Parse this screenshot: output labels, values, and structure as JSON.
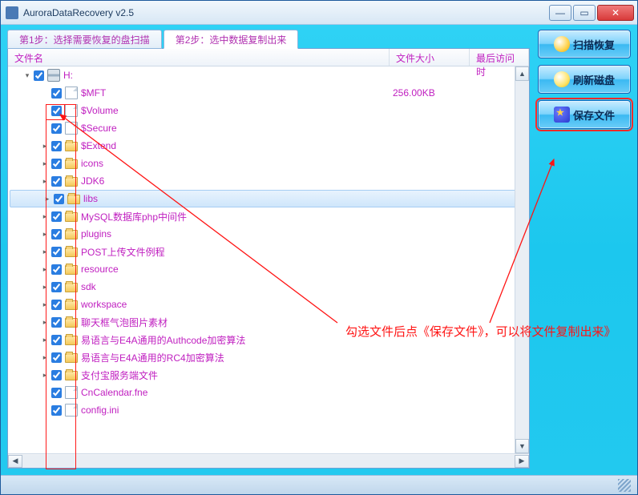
{
  "window": {
    "title": "AuroraDataRecovery v2.5"
  },
  "tabs": {
    "step1": "第1步：选择需要恢复的盘扫描",
    "step2": "第2步：选中数据复制出来"
  },
  "columns": {
    "name": "文件名",
    "size": "文件大小",
    "date": "最后访问时"
  },
  "tree": {
    "root": {
      "label": "H:",
      "size": ""
    },
    "items": [
      {
        "label": "$MFT",
        "type": "file",
        "size": "256.00KB"
      },
      {
        "label": "$Volume",
        "type": "file",
        "size": ""
      },
      {
        "label": "$Secure",
        "type": "file",
        "size": ""
      },
      {
        "label": "$Extend",
        "type": "folder",
        "size": ""
      },
      {
        "label": "icons",
        "type": "folder",
        "size": ""
      },
      {
        "label": "JDK6",
        "type": "folder",
        "size": ""
      },
      {
        "label": "libs",
        "type": "folder",
        "size": "",
        "selected": true
      },
      {
        "label": "MySQL数据库php中间件",
        "type": "folder",
        "size": ""
      },
      {
        "label": "plugins",
        "type": "folder",
        "size": ""
      },
      {
        "label": "POST上传文件例程",
        "type": "folder",
        "size": ""
      },
      {
        "label": "resource",
        "type": "folder",
        "size": ""
      },
      {
        "label": "sdk",
        "type": "folder",
        "size": ""
      },
      {
        "label": "workspace",
        "type": "folder",
        "size": ""
      },
      {
        "label": "聊天框气泡图片素材",
        "type": "folder",
        "size": ""
      },
      {
        "label": "易语言与E4A通用的Authcode加密算法",
        "type": "folder",
        "size": ""
      },
      {
        "label": "易语言与E4A通用的RC4加密算法",
        "type": "folder",
        "size": ""
      },
      {
        "label": "支付宝服务端文件",
        "type": "folder",
        "size": ""
      },
      {
        "label": "CnCalendar.fne",
        "type": "file",
        "size": ""
      },
      {
        "label": "config.ini",
        "type": "file",
        "size": ""
      }
    ]
  },
  "buttons": {
    "scan": "扫描恢复",
    "refresh": "刷新磁盘",
    "save": "保存文件"
  },
  "annotation": "勾选文件后点《保存文件》，可以将文件复制出来》"
}
